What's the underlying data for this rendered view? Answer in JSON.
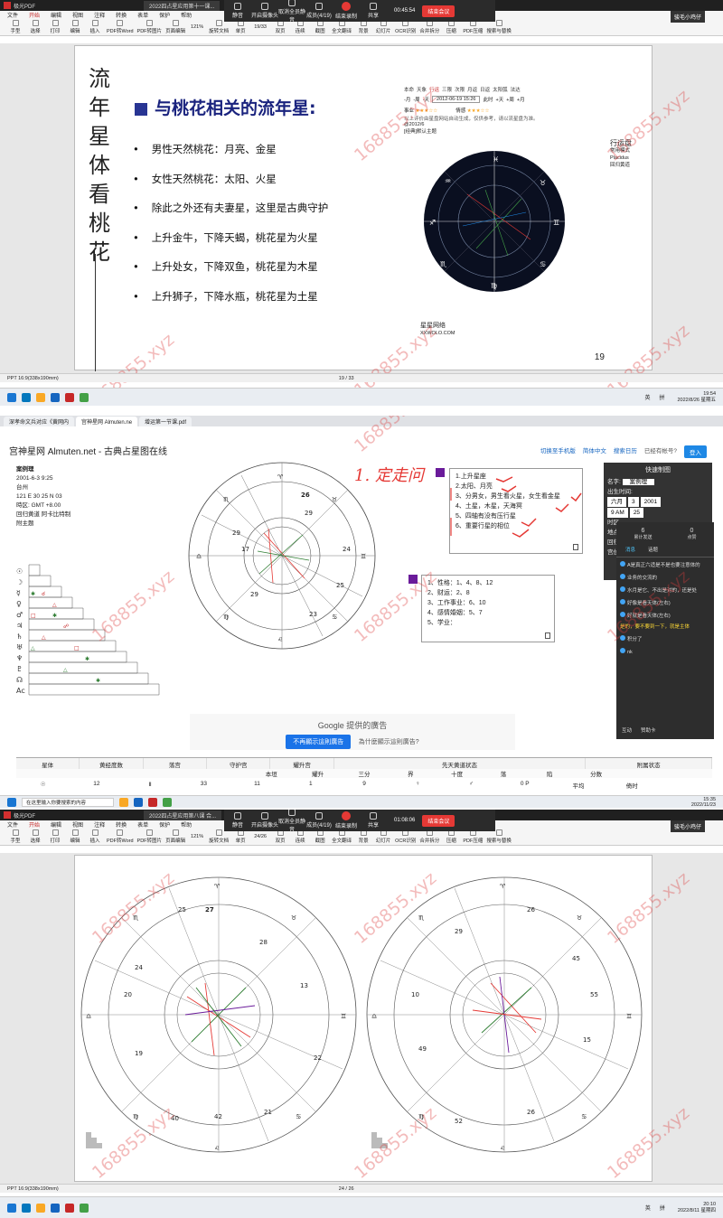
{
  "pdf1": {
    "app_title": "极光PDF",
    "doc_tab": "2022四占星应用第十一课...",
    "menus": [
      "文件",
      "开始",
      "编辑",
      "视图",
      "注释",
      "转换",
      "表单",
      "保护",
      "帮助"
    ],
    "active_menu": "开始",
    "tools": [
      "手型",
      "选择",
      "打印",
      "编辑",
      "插入",
      "PDF转Word",
      "PDF转图片",
      "页面编辑",
      "旋转文档",
      "单页",
      "双页",
      "连续",
      "截图",
      "全文翻译",
      "背景",
      "幻灯片",
      "OCR识别",
      "合并拆分",
      "压缩",
      "PDF压缩",
      "搜索与替换"
    ],
    "zoom": "121%",
    "page_nav": "19/33",
    "status_left": "PPT 16:9(338x190mm)",
    "status_page": "19 / 33"
  },
  "meeting1": {
    "tools": [
      "静音",
      "开启摄像头",
      "取消全员静音",
      "成员(4/19)",
      "结束录制",
      "共享"
    ],
    "time": "00:45:54",
    "end_label": "结束会议",
    "user": "骏毛小鸡仔"
  },
  "slide1": {
    "vertical_title": [
      "流",
      "年",
      "星",
      "体",
      "看",
      "桃",
      "花"
    ],
    "heading": "与桃花相关的流年星:",
    "bullets": [
      "男性天然桃花：月亮、金星",
      "女性天然桃花：太阳、火星",
      "除此之外还有夫妻星，这里是古典守护",
      "上升金牛，下降天蝎，桃花星为火星",
      "上升处女，下降双鱼，桃花星为木星",
      "上升狮子，下降水瓶，桃花星为土星"
    ],
    "page_number": "19",
    "chart_nav": [
      "本命",
      "天象",
      "行运",
      "三限",
      "次限",
      "月返",
      "日返",
      "太阳弧",
      "法达"
    ],
    "chart_date": "2012-06-19 15:26",
    "chart_controls": [
      "-月",
      "-周",
      "-天",
      "此时",
      "+天",
      "+周",
      "+月"
    ],
    "chart_rating1": "事业",
    "chart_rating2": "情感",
    "chart_caption": "以上评价由星盘网站自动生成，仅供参考，请以流星盘为准。",
    "chart_date_label": "@2012/6",
    "chart_default": "[经典]默认主题",
    "chart_side": [
      "行运盘",
      "常用模式",
      "Placidus",
      "回归黄道"
    ],
    "chart_site": "星星网络",
    "chart_site_url": "XXWOLO.COM"
  },
  "taskbar1": {
    "lang": "英",
    "ime": "拼",
    "time": "19:54",
    "date": "2022/8/26 星期五"
  },
  "browser": {
    "tabs": [
      "深孝命文兵对应《黄网内",
      "宫神星网 Almuten.ne",
      "增运第一节课.pdf"
    ],
    "site_title": "宫神星网 Almuten.net - 古典占星图在线",
    "links": [
      "切换至手机版",
      "简体中文",
      "搜索日历",
      "已经有帐号?",
      "登入"
    ],
    "birth_info": [
      "案例理",
      "2001-6-3 9:25",
      "台州",
      "121 E 30  25 N 03",
      "時区: GMT +8.00",
      "回归黄道 阿卡比特制",
      "附主题"
    ],
    "handwriting": "1. 定走问",
    "notes1": [
      "1.上升星座",
      "2.太阳、月亮",
      "3、分男女，男生看火星，女生看金星",
      "4、土星，木星，天海冥",
      "5、四轴有没有压行星",
      "6、重要行星的相位"
    ],
    "notes2": [
      "1、性格：1、4、8、12",
      "2、财运：2、8",
      "3、工作事业：6、10",
      "4、感情婚姻：5、7",
      "5、学业："
    ],
    "quick_title": "快速制图",
    "quick_fields": [
      "名字:",
      "出生时间:",
      "时区",
      "地点",
      "回归",
      "宫位"
    ],
    "quick_name": "案例理",
    "quick_month": "六月",
    "quick_day": "3",
    "quick_year": "2001",
    "quick_hour": "9 AM",
    "quick_min": "25",
    "chat_counts": [
      "6",
      "0"
    ],
    "chat_count_labels": [
      "累计发送",
      "点赞"
    ],
    "chat_tabs": [
      "消息",
      "话题"
    ],
    "chat_msgs": [
      "A是真正六适是不是也要注意体的",
      "业务的交流的",
      "水月是它、不出是对的，还是处",
      "好像是看天体(左右)",
      "好就是看天体(左右)",
      "是的，要不要到一下，就是主体",
      "积分了",
      "nk"
    ],
    "chat_footer": [
      "互动",
      "赞助卡"
    ],
    "ad_title": "Google 提供的廣告",
    "ad_btn": "不再顯示這則廣告",
    "ad_why": "為什麼顯示這則廣告?",
    "table_headers": [
      "星体",
      "黄经度数",
      "落宫",
      "守护宫",
      "耀升宫",
      "先天黄道状态",
      "",
      "",
      "",
      "",
      "",
      "附属状态"
    ],
    "table_subheaders": [
      "本垣",
      "耀升",
      "三分",
      "界",
      "十度",
      "落",
      "陷",
      "分数"
    ],
    "table_row": [
      "☉",
      "12",
      "Ⅱ",
      "33",
      "11",
      "1",
      "9",
      "",
      "",
      "",
      "♀",
      "♂",
      "",
      "",
      "0 P",
      "平均",
      "倚时"
    ]
  },
  "taskbar2": {
    "search": "在这里输入你要搜索的内容",
    "time": "15:35",
    "date": "2022/11/23"
  },
  "pdf3": {
    "doc_tab": "2022四占星应用第八课 合...",
    "page_nav": "24/26",
    "status_page": "24 / 26",
    "zoom": "121%"
  },
  "meeting3": {
    "time": "01:08:06"
  },
  "taskbar3": {
    "time": "20:10",
    "date": "2022/8/11 星期四"
  },
  "watermark": "168855.xyz",
  "colors": {
    "heading": "#1a237e",
    "accent_red": "#c62828",
    "chart_bg": "#0a0f20"
  }
}
